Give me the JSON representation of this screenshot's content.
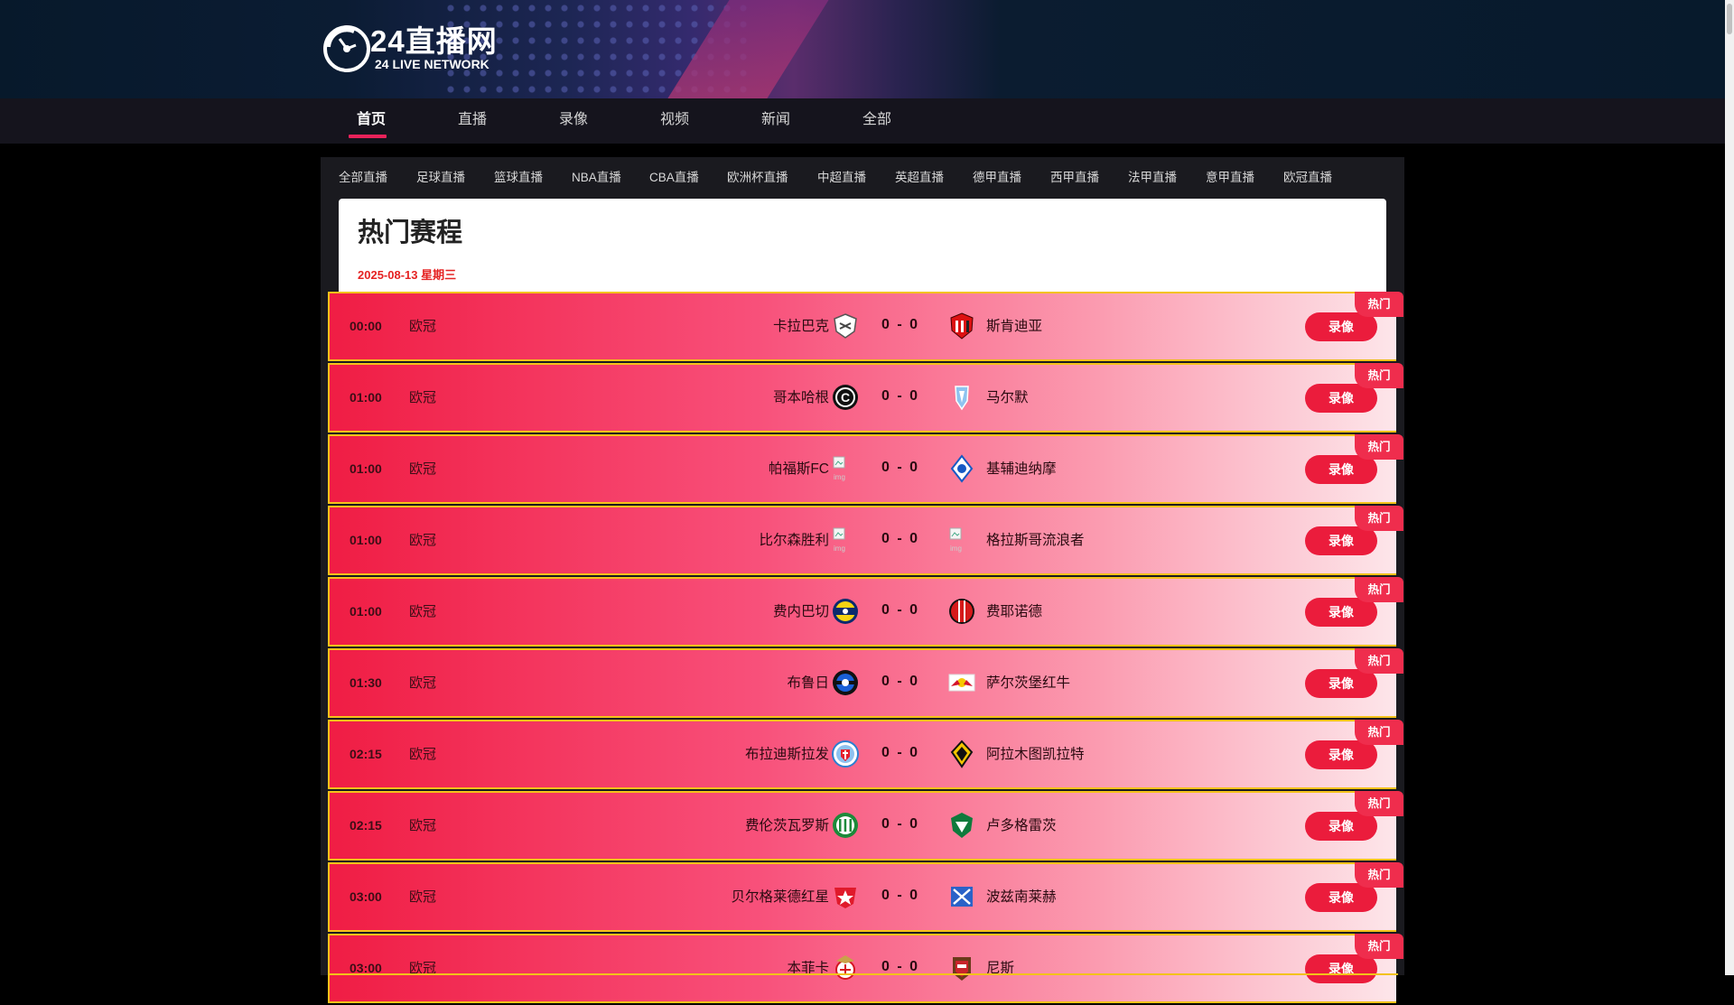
{
  "logo": {
    "cn": "24直播网",
    "en": "24 LIVE NETWORK"
  },
  "nav": [
    {
      "label": "首页",
      "active": true
    },
    {
      "label": "直播"
    },
    {
      "label": "录像"
    },
    {
      "label": "视频"
    },
    {
      "label": "新闻"
    },
    {
      "label": "全部"
    }
  ],
  "categories": [
    "全部直播",
    "足球直播",
    "篮球直播",
    "NBA直播",
    "CBA直播",
    "欧洲杯直播",
    "中超直播",
    "英超直播",
    "德甲直播",
    "西甲直播",
    "法甲直播",
    "意甲直播",
    "欧冠直播"
  ],
  "section": {
    "title": "热门赛程",
    "date": "2025-08-13 星期三"
  },
  "matches": [
    {
      "time": "00:00",
      "league": "欧冠",
      "home": "卡拉巴克",
      "away": "斯肯迪亚",
      "home_score": "0",
      "away_score": "0",
      "button": "录像",
      "badge": "热门",
      "home_icon": "qarabag-crest-icon",
      "away_icon": "shkendija-crest-icon"
    },
    {
      "time": "01:00",
      "league": "欧冠",
      "home": "哥本哈根",
      "away": "马尔默",
      "home_score": "0",
      "away_score": "0",
      "button": "录像",
      "badge": "热门",
      "home_icon": "copenhagen-crest-icon",
      "away_icon": "malmo-crest-icon"
    },
    {
      "time": "01:00",
      "league": "欧冠",
      "home": "帕福斯FC",
      "away": "基辅迪纳摩",
      "home_score": "0",
      "away_score": "0",
      "button": "录像",
      "badge": "热门",
      "home_icon": "broken-image-icon",
      "away_icon": "dynamo-kyiv-crest-icon"
    },
    {
      "time": "01:00",
      "league": "欧冠",
      "home": "比尔森胜利",
      "away": "格拉斯哥流浪者",
      "home_score": "0",
      "away_score": "0",
      "button": "录像",
      "badge": "热门",
      "home_icon": "broken-image-icon",
      "away_icon": "broken-image-icon"
    },
    {
      "time": "01:00",
      "league": "欧冠",
      "home": "费内巴切",
      "away": "费耶诺德",
      "home_score": "0",
      "away_score": "0",
      "button": "录像",
      "badge": "热门",
      "home_icon": "fenerbahce-crest-icon",
      "away_icon": "feyenoord-crest-icon"
    },
    {
      "time": "01:30",
      "league": "欧冠",
      "home": "布鲁日",
      "away": "萨尔茨堡红牛",
      "home_score": "0",
      "away_score": "0",
      "button": "录像",
      "badge": "热门",
      "home_icon": "club-brugge-crest-icon",
      "away_icon": "salzburg-crest-icon"
    },
    {
      "time": "02:15",
      "league": "欧冠",
      "home": "布拉迪斯拉发",
      "away": "阿拉木图凯拉特",
      "home_score": "0",
      "away_score": "0",
      "button": "录像",
      "badge": "热门",
      "home_icon": "slovan-bratislava-crest-icon",
      "away_icon": "kairat-crest-icon"
    },
    {
      "time": "02:15",
      "league": "欧冠",
      "home": "费伦茨瓦罗斯",
      "away": "卢多格雷茨",
      "home_score": "0",
      "away_score": "0",
      "button": "录像",
      "badge": "热门",
      "home_icon": "ferencvaros-crest-icon",
      "away_icon": "ludogorets-crest-icon"
    },
    {
      "time": "03:00",
      "league": "欧冠",
      "home": "贝尔格莱德红星",
      "away": "波兹南莱赫",
      "home_score": "0",
      "away_score": "0",
      "button": "录像",
      "badge": "热门",
      "home_icon": "red-star-crest-icon",
      "away_icon": "lech-poznan-crest-icon"
    },
    {
      "time": "03:00",
      "league": "欧冠",
      "home": "本菲卡",
      "away": "尼斯",
      "home_score": "0",
      "away_score": "0",
      "button": "录像",
      "badge": "热门",
      "home_icon": "benfica-crest-icon",
      "away_icon": "nice-crest-icon"
    }
  ]
}
